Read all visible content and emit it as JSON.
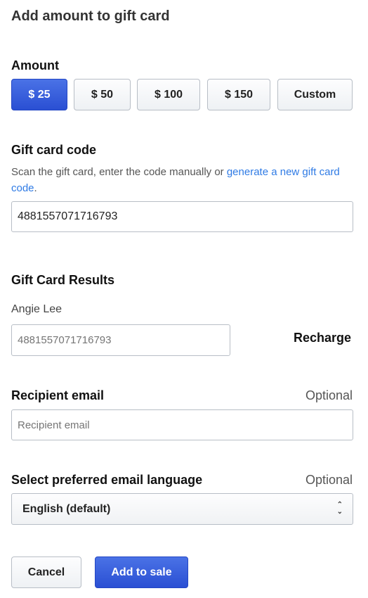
{
  "title": "Add amount to gift card",
  "amount": {
    "label": "Amount",
    "options": [
      "$ 25",
      "$ 50",
      "$ 100",
      "$ 150",
      "Custom"
    ],
    "selected": "$ 25"
  },
  "code": {
    "label": "Gift card code",
    "desc_prefix": "Scan the gift card, enter the code manually or ",
    "desc_link": "generate a new gift card code",
    "desc_suffix": ".",
    "value": "4881557071716793"
  },
  "results": {
    "label": "Gift Card Results",
    "name": "Angie Lee",
    "placeholder": "4881557071716793",
    "recharge": "Recharge"
  },
  "recipient": {
    "label": "Recipient email",
    "optional": "Optional",
    "placeholder": "Recipient email"
  },
  "language": {
    "label": "Select preferred email language",
    "optional": "Optional",
    "value": "English (default)",
    "chevron": "updown-chevron-icon"
  },
  "actions": {
    "cancel": "Cancel",
    "add": "Add to sale"
  },
  "colors": {
    "primary": "#3a5fdc",
    "link": "#2f7be5"
  }
}
